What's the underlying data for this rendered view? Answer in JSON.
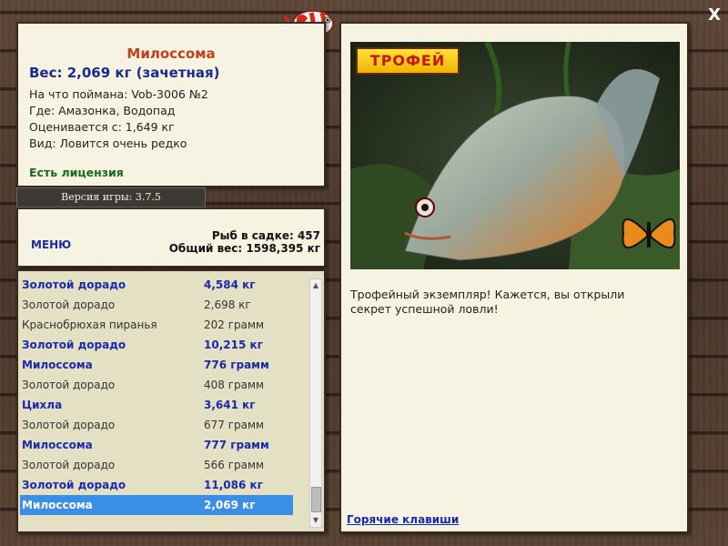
{
  "window": {
    "close_label": "X"
  },
  "fish_info": {
    "title": "Милоссома",
    "weight": "Вес: 2,069 кг (зачетная)",
    "bait": "На что поймана: Vob-3006 №2",
    "location": "Где: Амазонка, Водопад",
    "valued_from": "Оценивается с: 1,649 кг",
    "rarity": "Вид: Ловится очень редко",
    "license": "Есть лицензия"
  },
  "version": {
    "label": "Версия игры: 3.7.5"
  },
  "stats": {
    "menu_label": "МЕНЮ",
    "fish_count": "Рыб в садке: 457",
    "total_weight": "Общий вес: 1598,395 кг"
  },
  "catch_list": [
    {
      "name": "Золотой дорадо",
      "weight": "4,584 кг",
      "bold": true
    },
    {
      "name": "Золотой дорадо",
      "weight": "2,698 кг",
      "bold": false
    },
    {
      "name": "Краснобрюхая пиранья",
      "weight": "202 грамм",
      "bold": false
    },
    {
      "name": "Золотой дорадо",
      "weight": "10,215 кг",
      "bold": true
    },
    {
      "name": "Милоссома",
      "weight": "776 грамм",
      "bold": true
    },
    {
      "name": "Золотой дорадо",
      "weight": "408 грамм",
      "bold": false
    },
    {
      "name": "Цихла",
      "weight": "3,641 кг",
      "bold": true
    },
    {
      "name": "Золотой дорадо",
      "weight": "677 грамм",
      "bold": false
    },
    {
      "name": "Милоссома",
      "weight": "777 грамм",
      "bold": true
    },
    {
      "name": "Золотой дорадо",
      "weight": "566 грамм",
      "bold": false
    },
    {
      "name": "Золотой дорадо",
      "weight": "11,086 кг",
      "bold": true
    },
    {
      "name": "Милоссома",
      "weight": "2,069 кг",
      "bold": true,
      "selected": true
    }
  ],
  "detail": {
    "trophy_badge": "ТРОФЕЙ",
    "message": "Трофейный экземпляр! Кажется, вы открыли секрет успешной ловли!",
    "hotkeys_label": "Горячие клавиши"
  },
  "colors": {
    "panel_bg": "#f6f3e2",
    "title_red": "#c0401a",
    "accent_blue": "#1a2baa",
    "license_green": "#1a6a1a",
    "selection_blue": "#3b8ee6"
  }
}
